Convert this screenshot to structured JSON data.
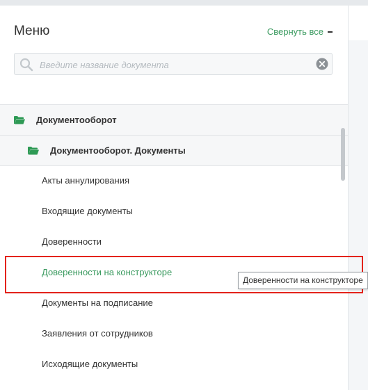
{
  "menu": {
    "title": "Меню",
    "collapse_label": "Свернуть все",
    "search_placeholder": "Введите название документа",
    "groups": [
      {
        "label": "Документооборот",
        "icon": "folder-open-icon"
      },
      {
        "label": "Документооборот. Документы",
        "icon": "folder-open-icon"
      }
    ],
    "items": [
      {
        "label": "Акты аннулирования"
      },
      {
        "label": "Входящие документы"
      },
      {
        "label": "Доверенности"
      },
      {
        "label": "Доверенности на конструкторе",
        "active": true
      },
      {
        "label": "Документы на подписание"
      },
      {
        "label": "Заявления от сотрудников"
      },
      {
        "label": "Исходящие документы"
      }
    ]
  },
  "tooltip": {
    "text": "Доверенности на конструкторе"
  },
  "colors": {
    "accent": "#3a9a5f",
    "highlight_box": "#e3231b"
  }
}
